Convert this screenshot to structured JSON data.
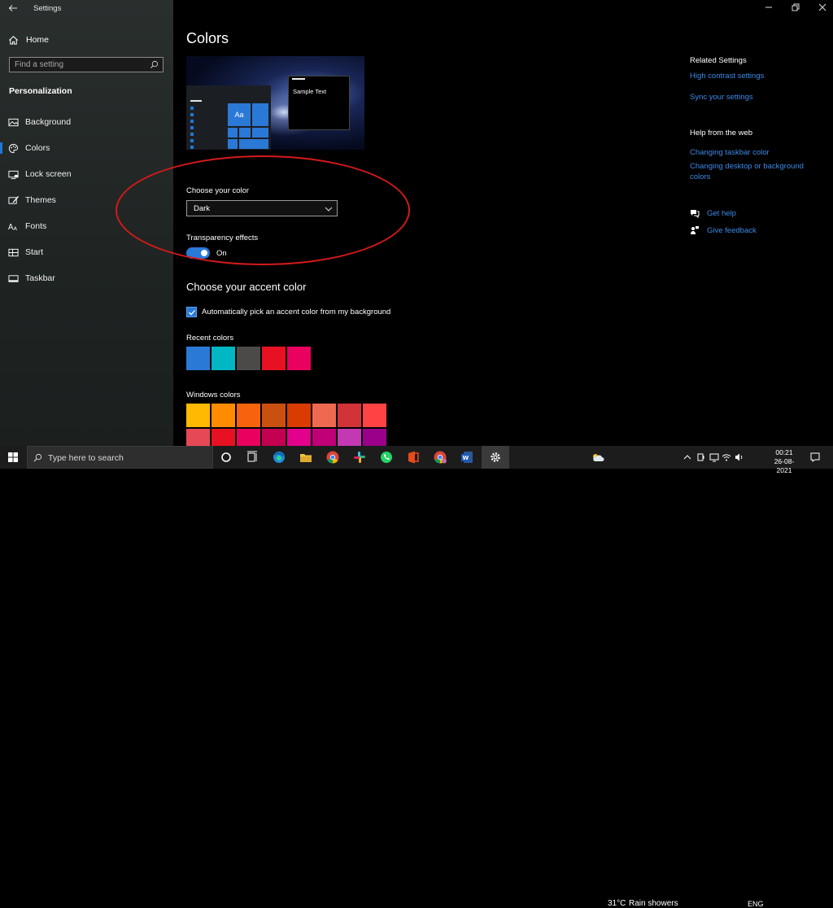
{
  "window": {
    "title": "Settings",
    "controls": [
      "minimize",
      "restore",
      "close"
    ]
  },
  "sidebar": {
    "home_label": "Home",
    "search_placeholder": "Find a setting",
    "section": "Personalization",
    "items": [
      {
        "label": "Background",
        "icon": "picture-icon"
      },
      {
        "label": "Colors",
        "icon": "palette-icon",
        "active": true
      },
      {
        "label": "Lock screen",
        "icon": "monitor-lock-icon"
      },
      {
        "label": "Themes",
        "icon": "brush-icon"
      },
      {
        "label": "Fonts",
        "icon": "font-icon"
      },
      {
        "label": "Start",
        "icon": "start-grid-icon"
      },
      {
        "label": "Taskbar",
        "icon": "taskbar-icon"
      }
    ]
  },
  "main": {
    "title": "Colors",
    "preview": {
      "sample_text": "Sample Text",
      "tile_text": "Aa"
    },
    "choose_color": {
      "label": "Choose your color",
      "value": "Dark"
    },
    "transparency": {
      "label": "Transparency effects",
      "state": "On"
    },
    "accent": {
      "title": "Choose your accent color",
      "auto_pick_label": "Automatically pick an accent color from my background",
      "auto_pick_checked": true,
      "recent_label": "Recent colors",
      "recent_colors": [
        "#2b79d6",
        "#00b7c3",
        "#4c4a48",
        "#e81123",
        "#ea005e"
      ],
      "windows_label": "Windows colors",
      "windows_colors_row1": [
        "#ffb900",
        "#ff8c00",
        "#f7630c",
        "#ca5010",
        "#da3b01",
        "#ef6950",
        "#d13438",
        "#ff4343"
      ],
      "windows_colors_row2": [
        "#e74856",
        "#e81123",
        "#ea005e",
        "#c30052",
        "#e3008c",
        "#bf0077",
        "#c239b3",
        "#9a0089"
      ]
    }
  },
  "related": {
    "heading": "Related Settings",
    "links": [
      "High contrast settings",
      "Sync your settings"
    ]
  },
  "help": {
    "heading": "Help from the web",
    "links": [
      "Changing taskbar color",
      "Changing desktop or background colors"
    ],
    "get_help": "Get help",
    "give_feedback": "Give feedback"
  },
  "taskbar": {
    "search_placeholder": "Type here to search",
    "weather_temp": "31°C",
    "weather_desc": "Rain showers",
    "language": "ENG",
    "time": "00:21",
    "date": "26-08-2021",
    "accent_color": "#2b79d6"
  }
}
